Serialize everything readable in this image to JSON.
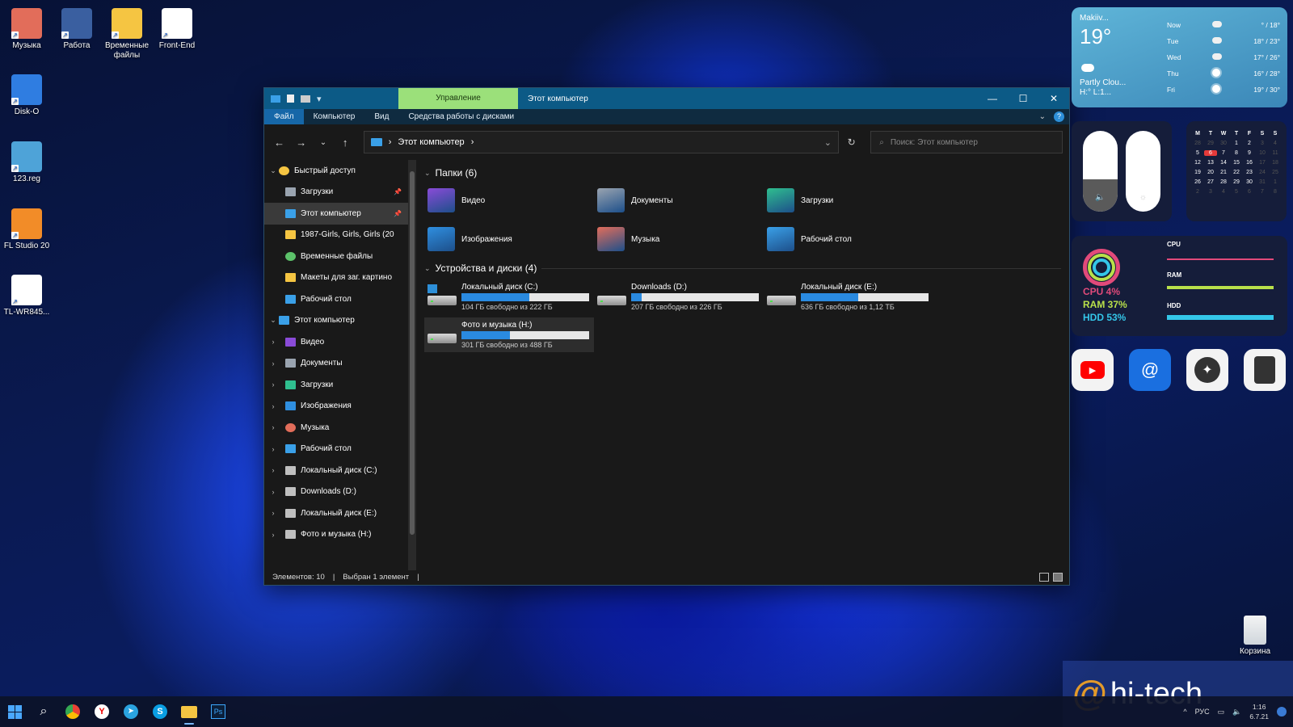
{
  "desktop": {
    "icons": [
      {
        "label": "Музыка",
        "color": "#e26d5a"
      },
      {
        "label": "Работа",
        "color": "#3a5fa0"
      },
      {
        "label": "Временные файлы",
        "color": "#f5c542"
      },
      {
        "label": "Front-End",
        "color": "#ffffff"
      },
      {
        "label": "Disk-O",
        "color": "#2f7de1"
      },
      {
        "label": "123.reg",
        "color": "#4ea3d8"
      },
      {
        "label": "FL Studio 20",
        "color": "#f28c28"
      },
      {
        "label": "TL-WR845...",
        "color": "#ffffff"
      }
    ],
    "recycle_bin": "Корзина"
  },
  "explorer": {
    "title_tab_manage": "Управление",
    "title": "Этот компьютер",
    "window_controls": {
      "minimize": "—",
      "maximize": "☐",
      "close": "✕"
    },
    "ribbon_tabs": [
      "Файл",
      "Компьютер",
      "Вид",
      "Средства работы с дисками"
    ],
    "address": {
      "path": "Этот компьютер",
      "separator": "›"
    },
    "search": {
      "placeholder": "Поиск: Этот компьютер"
    },
    "sidebar": [
      {
        "label": "Быстрый доступ",
        "level": 0,
        "expanded": true,
        "icon": "star-icon",
        "color": "#f5c542"
      },
      {
        "label": "Загрузки",
        "level": 1,
        "pinned": true,
        "icon": "download-icon",
        "color": "#9aa4b0"
      },
      {
        "label": "Этот компьютер",
        "level": 1,
        "pinned": true,
        "selected": true,
        "icon": "computer-icon",
        "color": "#3aa0e8"
      },
      {
        "label": "1987-Girls, Girls, Girls (20",
        "level": 1,
        "icon": "folder-icon",
        "color": "#f5c542"
      },
      {
        "label": "Временные файлы",
        "level": 1,
        "icon": "check-icon",
        "color": "#5cc26a"
      },
      {
        "label": "Макеты для заг. картино",
        "level": 1,
        "icon": "folder-icon",
        "color": "#f5c542"
      },
      {
        "label": "Рабочий стол",
        "level": 1,
        "icon": "desktop-icon",
        "color": "#3aa0e8"
      },
      {
        "label": "Этот компьютер",
        "level": 0,
        "expanded": true,
        "icon": "computer-icon",
        "color": "#3aa0e8"
      },
      {
        "label": "Видео",
        "level": 1,
        "icon": "video-icon",
        "color": "#8a4bd8"
      },
      {
        "label": "Документы",
        "level": 1,
        "icon": "documents-icon",
        "color": "#9aa4b0"
      },
      {
        "label": "Загрузки",
        "level": 1,
        "icon": "download-icon",
        "color": "#2fbf8f"
      },
      {
        "label": "Изображения",
        "level": 1,
        "icon": "pictures-icon",
        "color": "#2f8fe0"
      },
      {
        "label": "Музыка",
        "level": 1,
        "icon": "music-icon",
        "color": "#e26d5a"
      },
      {
        "label": "Рабочий стол",
        "level": 1,
        "icon": "desktop-icon",
        "color": "#3aa0e8"
      },
      {
        "label": "Локальный диск (C:)",
        "level": 1,
        "icon": "drive-icon",
        "color": "#bfbfbf"
      },
      {
        "label": "Downloads (D:)",
        "level": 1,
        "icon": "drive-icon",
        "color": "#bfbfbf"
      },
      {
        "label": "Локальный диск (E:)",
        "level": 1,
        "icon": "drive-icon",
        "color": "#bfbfbf"
      },
      {
        "label": "Фото и музыка (H:)",
        "level": 1,
        "icon": "drive-icon",
        "color": "#bfbfbf"
      }
    ],
    "folders_header": "Папки (6)",
    "folders": [
      {
        "label": "Видео",
        "icon": "video-folder-icon",
        "color": "#8a4bd8"
      },
      {
        "label": "Документы",
        "icon": "documents-folder-icon",
        "color": "#9aa4b0"
      },
      {
        "label": "Загрузки",
        "icon": "downloads-folder-icon",
        "color": "#2fbf8f"
      },
      {
        "label": "Изображения",
        "icon": "pictures-folder-icon",
        "color": "#2f8fe0"
      },
      {
        "label": "Музыка",
        "icon": "music-folder-icon",
        "color": "#e26d5a"
      },
      {
        "label": "Рабочий стол",
        "icon": "desktop-folder-icon",
        "color": "#3aa0e8"
      }
    ],
    "drives_header": "Устройства и диски (4)",
    "drives": [
      {
        "label": "Локальный диск (C:)",
        "free": "104 ГБ свободно из 222 ГБ",
        "used_fraction": 0.53,
        "windows": true
      },
      {
        "label": "Downloads (D:)",
        "free": "207 ГБ свободно из 226 ГБ",
        "used_fraction": 0.08
      },
      {
        "label": "Локальный диск (E:)",
        "free": "636 ГБ свободно из 1,12 ТБ",
        "used_fraction": 0.45
      },
      {
        "label": "Фото и музыка (H:)",
        "free": "301 ГБ свободно из 488 ГБ",
        "used_fraction": 0.38,
        "selected": true
      }
    ],
    "status": {
      "items": "Элементов: 10",
      "selected": "Выбран 1 элемент"
    }
  },
  "weather": {
    "location": "Makiiv...",
    "temp": "19°",
    "condition": "Partly Clou...",
    "hilo": "H:° L:1...",
    "forecast": [
      {
        "day": "Now",
        "icon": "cloud-icon",
        "temps": "° / 18°"
      },
      {
        "day": "Tue",
        "icon": "cloud-icon",
        "temps": "18° / 23°"
      },
      {
        "day": "Wed",
        "icon": "storm-icon",
        "temps": "17° / 26°"
      },
      {
        "day": "Thu",
        "icon": "sun-icon",
        "temps": "16° / 28°"
      },
      {
        "day": "Fri",
        "icon": "sun-icon",
        "temps": "19° / 30°"
      }
    ]
  },
  "sliders": {
    "volume": 0.4,
    "brightness": 0.0
  },
  "calendar": {
    "dow": [
      "M",
      "T",
      "W",
      "T",
      "F",
      "S",
      "S"
    ],
    "weeks": [
      [
        {
          "d": "28",
          "dim": true
        },
        {
          "d": "29",
          "dim": true
        },
        {
          "d": "30",
          "dim": true
        },
        {
          "d": "1"
        },
        {
          "d": "2"
        },
        {
          "d": "3",
          "dim": true
        },
        {
          "d": "4",
          "dim": true
        }
      ],
      [
        {
          "d": "5"
        },
        {
          "d": "6",
          "today": true
        },
        {
          "d": "7"
        },
        {
          "d": "8"
        },
        {
          "d": "9"
        },
        {
          "d": "10",
          "dim": true
        },
        {
          "d": "11",
          "dim": true
        }
      ],
      [
        {
          "d": "12"
        },
        {
          "d": "13"
        },
        {
          "d": "14"
        },
        {
          "d": "15"
        },
        {
          "d": "16"
        },
        {
          "d": "17",
          "dim": true
        },
        {
          "d": "18",
          "dim": true
        }
      ],
      [
        {
          "d": "19"
        },
        {
          "d": "20"
        },
        {
          "d": "21"
        },
        {
          "d": "22"
        },
        {
          "d": "23"
        },
        {
          "d": "24",
          "dim": true
        },
        {
          "d": "25",
          "dim": true
        }
      ],
      [
        {
          "d": "26"
        },
        {
          "d": "27"
        },
        {
          "d": "28"
        },
        {
          "d": "29"
        },
        {
          "d": "30"
        },
        {
          "d": "31",
          "dim": true
        },
        {
          "d": "1",
          "dim": true
        }
      ],
      [
        {
          "d": "2",
          "dim": true
        },
        {
          "d": "3",
          "dim": true
        },
        {
          "d": "4",
          "dim": true
        },
        {
          "d": "5",
          "dim": true
        },
        {
          "d": "6",
          "dim": true
        },
        {
          "d": "7",
          "dim": true
        },
        {
          "d": "8",
          "dim": true
        }
      ]
    ]
  },
  "monitor": {
    "cpu_text": "CPU 4%",
    "ram_text": "RAM 37%",
    "hdd_text": "HDD 53%",
    "cpu_label": "CPU",
    "ram_label": "RAM",
    "hdd_label": "HDD",
    "colors": {
      "cpu": "#e14a7a",
      "ram": "#b9e04a",
      "hdd": "#34c6e8"
    }
  },
  "apps": [
    {
      "name": "youtube",
      "color": "#ff0000"
    },
    {
      "name": "mail",
      "color": "#1a6fe0"
    },
    {
      "name": "photos",
      "color": "#333333"
    },
    {
      "name": "calculator",
      "color": "#333333"
    }
  ],
  "taskbar": {
    "tray_lang": "РУС",
    "time": "1:16",
    "date": "6.7.21"
  },
  "watermark": {
    "at": "@",
    "brand": "hi-tech"
  }
}
